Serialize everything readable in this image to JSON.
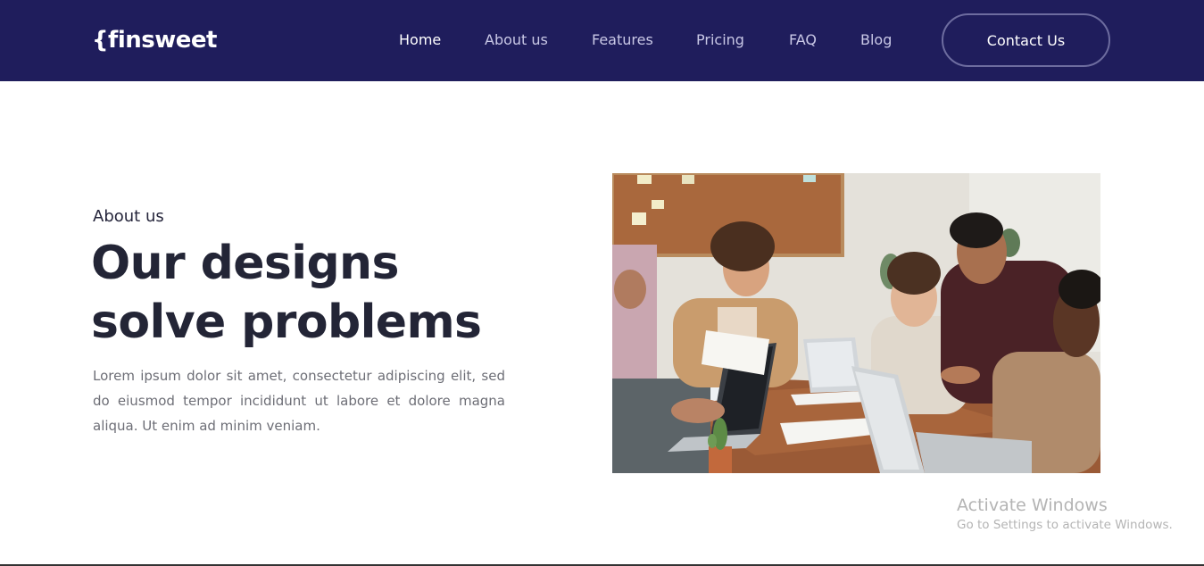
{
  "header": {
    "logo_text": "{finsweet",
    "background": "#1f1d5c",
    "nav": [
      {
        "label": "Home",
        "active": true
      },
      {
        "label": "About us",
        "active": false
      },
      {
        "label": "Features",
        "active": false
      },
      {
        "label": "Pricing",
        "active": false
      },
      {
        "label": "FAQ",
        "active": false
      },
      {
        "label": "Blog",
        "active": false
      }
    ],
    "contact_button": "Contact Us"
  },
  "hero": {
    "eyebrow": "About us",
    "headline_line1": "Our designs",
    "headline_line2": "solve problems",
    "body": "Lorem ipsum dolor sit amet, consectetur adipiscing elit, sed do eiusmod tempor incididunt ut labore et dolore magna aliqua. Ut enim ad minim veniam."
  },
  "watermark": {
    "title": "Activate Windows",
    "subtitle": "Go to Settings to activate Windows."
  }
}
